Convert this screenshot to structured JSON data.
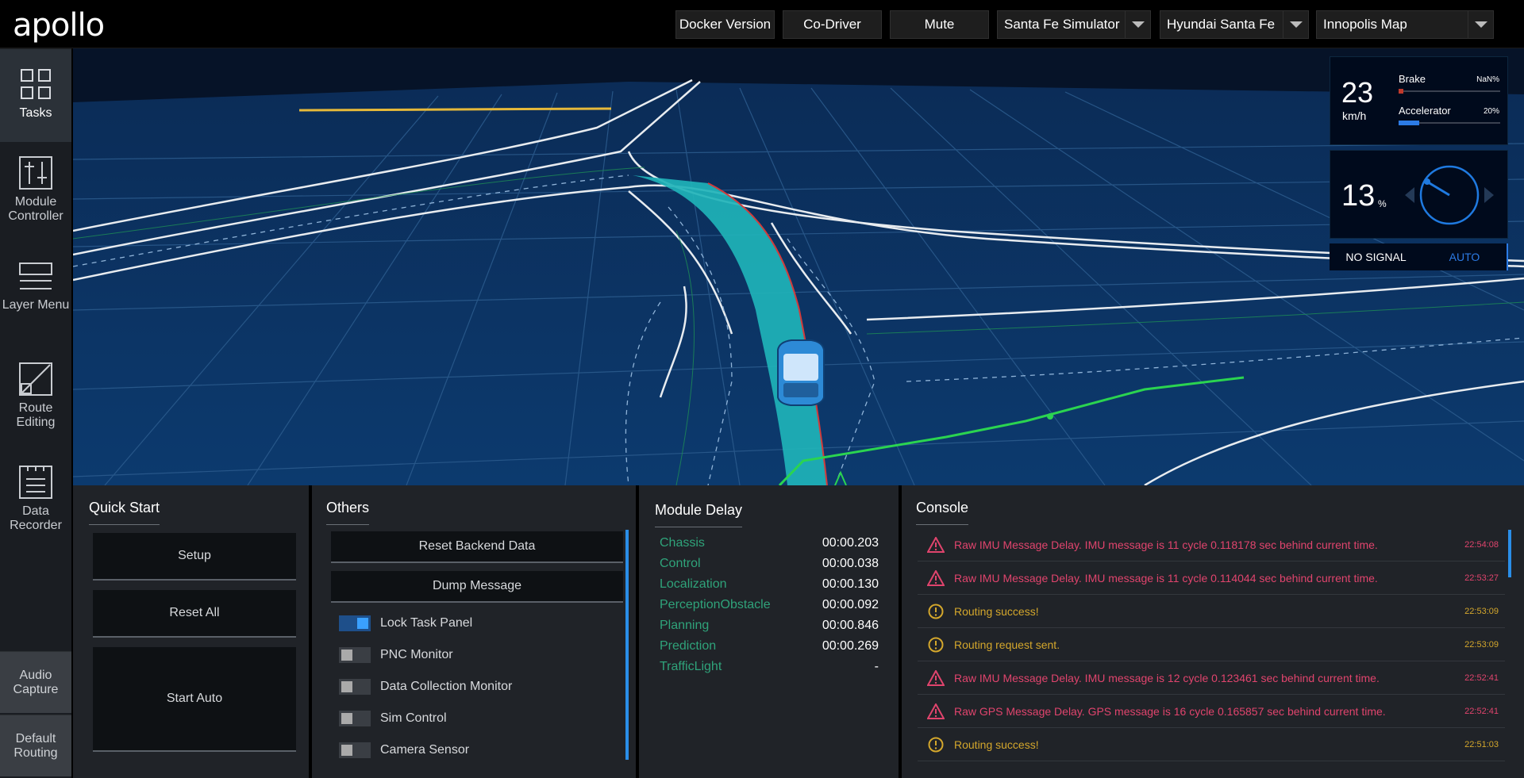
{
  "header": {
    "logo": "apollo",
    "buttons": {
      "docker": "Docker Version",
      "codriver": "Co-Driver",
      "mute": "Mute"
    },
    "selects": {
      "mode": "Santa Fe Simulator",
      "vehicle": "Hyundai Santa Fe",
      "map": "Innopolis Map"
    }
  },
  "sidebar": {
    "items": [
      {
        "label": "Tasks",
        "icon": "grid-icon"
      },
      {
        "label": "Module Controller",
        "icon": "sliders-icon"
      },
      {
        "label": "Layer Menu",
        "icon": "layers-icon"
      },
      {
        "label": "Route Editing",
        "icon": "route-edit-icon"
      },
      {
        "label": "Data Recorder",
        "icon": "recorder-icon"
      }
    ],
    "bottom": [
      "Audio Capture",
      "Default Routing"
    ]
  },
  "dashboard": {
    "speed": "23",
    "speed_unit": "km/h",
    "brake_label": "Brake",
    "brake_value": "NaN%",
    "brake_fraction": 0.0,
    "accel_label": "Accelerator",
    "accel_value": "20%",
    "accel_fraction": 0.2,
    "steering": "13",
    "steering_unit": "%",
    "signal": "NO SIGNAL",
    "drive_mode": "AUTO",
    "colors": {
      "brake": "#c0392b",
      "accel": "#2c7be5",
      "wheel": "#1f7ae0"
    }
  },
  "quick_start": {
    "title": "Quick Start",
    "buttons": [
      "Setup",
      "Reset All",
      "Start Auto"
    ]
  },
  "others": {
    "title": "Others",
    "buttons": [
      "Reset Backend Data",
      "Dump Message"
    ],
    "toggles": [
      {
        "label": "Lock Task Panel",
        "on": true
      },
      {
        "label": "PNC Monitor",
        "on": false
      },
      {
        "label": "Data Collection Monitor",
        "on": false
      },
      {
        "label": "Sim Control",
        "on": false
      },
      {
        "label": "Camera Sensor",
        "on": false
      }
    ]
  },
  "module_delay": {
    "title": "Module Delay",
    "rows": [
      {
        "name": "Chassis",
        "value": "00:00.203"
      },
      {
        "name": "Control",
        "value": "00:00.038"
      },
      {
        "name": "Localization",
        "value": "00:00.130"
      },
      {
        "name": "PerceptionObstacle",
        "value": "00:00.092"
      },
      {
        "name": "Planning",
        "value": "00:00.846"
      },
      {
        "name": "Prediction",
        "value": "00:00.269"
      },
      {
        "name": "TrafficLight",
        "value": "-"
      }
    ]
  },
  "console": {
    "title": "Console",
    "messages": [
      {
        "level": "error",
        "text": "Raw IMU Message Delay. IMU message is 11 cycle 0.118178 sec behind current time.",
        "time": "22:54:08"
      },
      {
        "level": "error",
        "text": "Raw IMU Message Delay. IMU message is 11 cycle 0.114044 sec behind current time.",
        "time": "22:53:27"
      },
      {
        "level": "warning",
        "text": "Routing success!",
        "time": "22:53:09"
      },
      {
        "level": "warning",
        "text": "Routing request sent.",
        "time": "22:53:09"
      },
      {
        "level": "error",
        "text": "Raw IMU Message Delay. IMU message is 12 cycle 0.123461 sec behind current time.",
        "time": "22:52:41"
      },
      {
        "level": "error",
        "text": "Raw GPS Message Delay. GPS message is 16 cycle 0.165857 sec behind current time.",
        "time": "22:52:41"
      },
      {
        "level": "warning",
        "text": "Routing success!",
        "time": "22:51:03"
      }
    ]
  }
}
